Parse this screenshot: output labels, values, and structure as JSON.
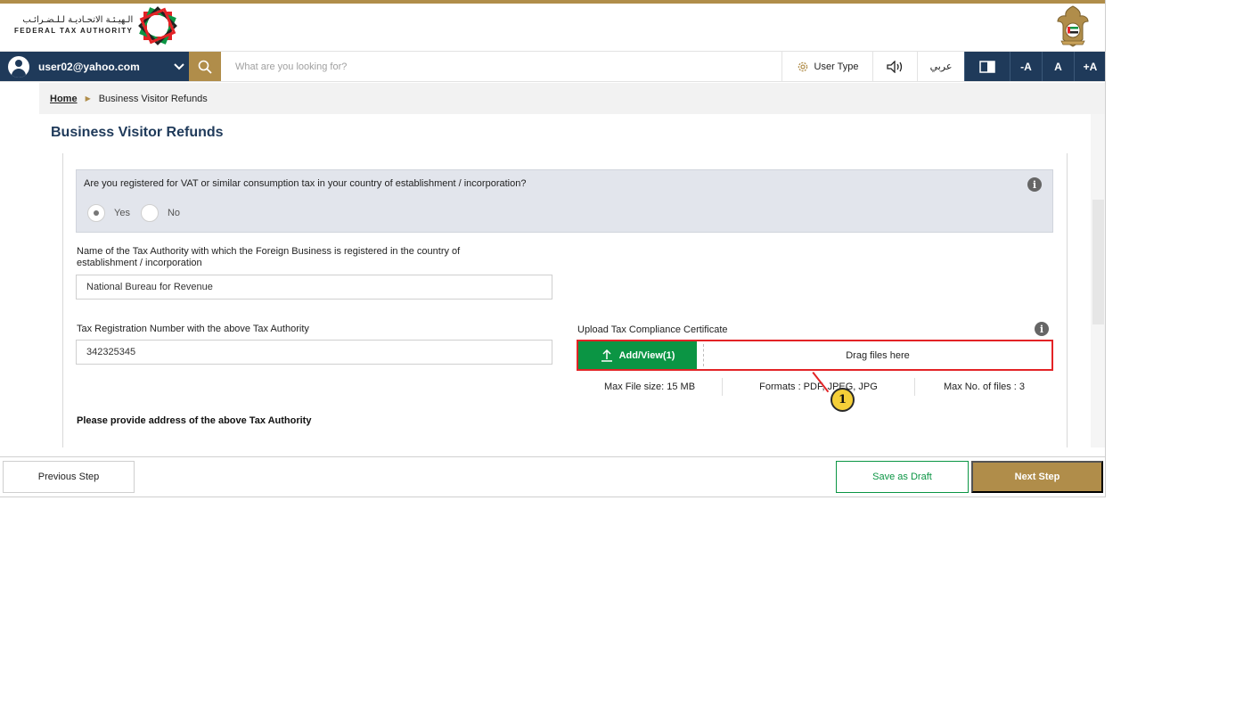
{
  "header": {
    "logo_arabic": "الـهيـئـة الاتحـاديـة لـلـضـرائـب",
    "logo_english": "FEDERAL TAX AUTHORITY"
  },
  "toolbar": {
    "user_email": "user02@yahoo.com",
    "search_placeholder": "What are you looking for?",
    "user_type_label": "User Type",
    "language_label": "عربي",
    "font_decrease": "-A",
    "font_reset": "A",
    "font_increase": "+A"
  },
  "breadcrumb": {
    "home": "Home",
    "current": "Business Visitor Refunds"
  },
  "page": {
    "title": "Business Visitor Refunds"
  },
  "form": {
    "vat_question": {
      "text": "Are you registered for VAT or similar consumption tax in your country of establishment / incorporation?",
      "options": [
        "Yes",
        "No"
      ],
      "selected": "Yes"
    },
    "tax_authority_name": {
      "label": "Name of the Tax Authority with which the Foreign Business is registered in the country of establishment / incorporation",
      "value": "National Bureau for Revenue"
    },
    "tax_registration_number": {
      "label": "Tax Registration Number with the above Tax Authority",
      "value": "342325345"
    },
    "upload": {
      "label": "Upload Tax Compliance Certificate",
      "button_label": "Add/View(1)",
      "drop_text": "Drag files here",
      "max_size": "Max File size: 15 MB",
      "formats": "Formats : PDF, JPEG, JPG",
      "max_files": "Max No. of files : 3"
    },
    "address_heading": "Please provide address of the above Tax Authority"
  },
  "annotation": {
    "marker_number": "1",
    "highlight_color": "#e32326"
  },
  "footer": {
    "previous_label": "Previous Step",
    "draft_label": "Save as Draft",
    "next_label": "Next Step"
  },
  "colors": {
    "brand_navy": "#1f3a5a",
    "brand_gold": "#b08d4a",
    "upload_green": "#0b9544"
  }
}
